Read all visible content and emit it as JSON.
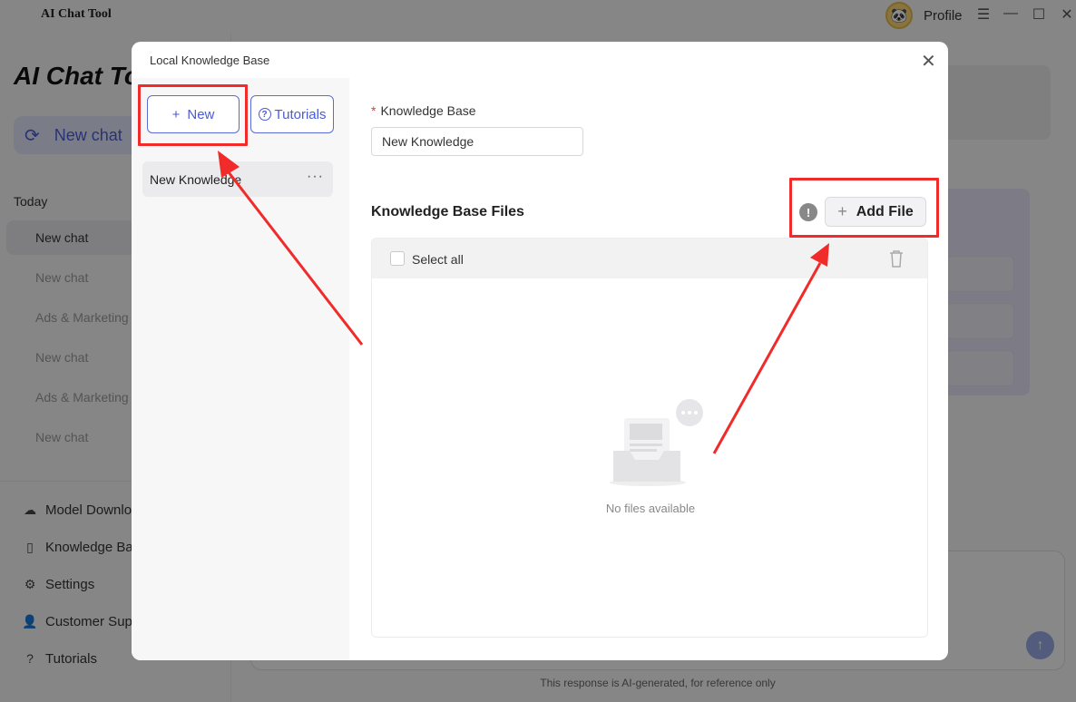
{
  "app": {
    "name": "AI Chat Tool",
    "profile_label": "Profile"
  },
  "sidebar": {
    "title": "AI Chat Tool",
    "new_chat": "New chat",
    "section_today": "Today",
    "chats": [
      "New chat",
      "New chat",
      "Ads & Marketing",
      "New chat",
      "Ads & Marketing",
      "New chat"
    ],
    "menu": [
      "Model Download",
      "Knowledge Base",
      "Settings",
      "Customer Support",
      "Tutorials"
    ]
  },
  "main": {
    "disclaimer": "This response is AI-generated, for reference only"
  },
  "modal": {
    "title": "Local Knowledge Base",
    "new_button": "New",
    "tutorials_button": "Tutorials",
    "kb_item": "New Knowledge",
    "field_label": "Knowledge Base",
    "field_value": "New Knowledge",
    "files_title": "Knowledge Base Files",
    "add_file": "Add File",
    "select_all": "Select all",
    "empty_text": "No files available"
  },
  "colors": {
    "accent": "#4a5bd6",
    "annotation": "#f12a2a"
  }
}
